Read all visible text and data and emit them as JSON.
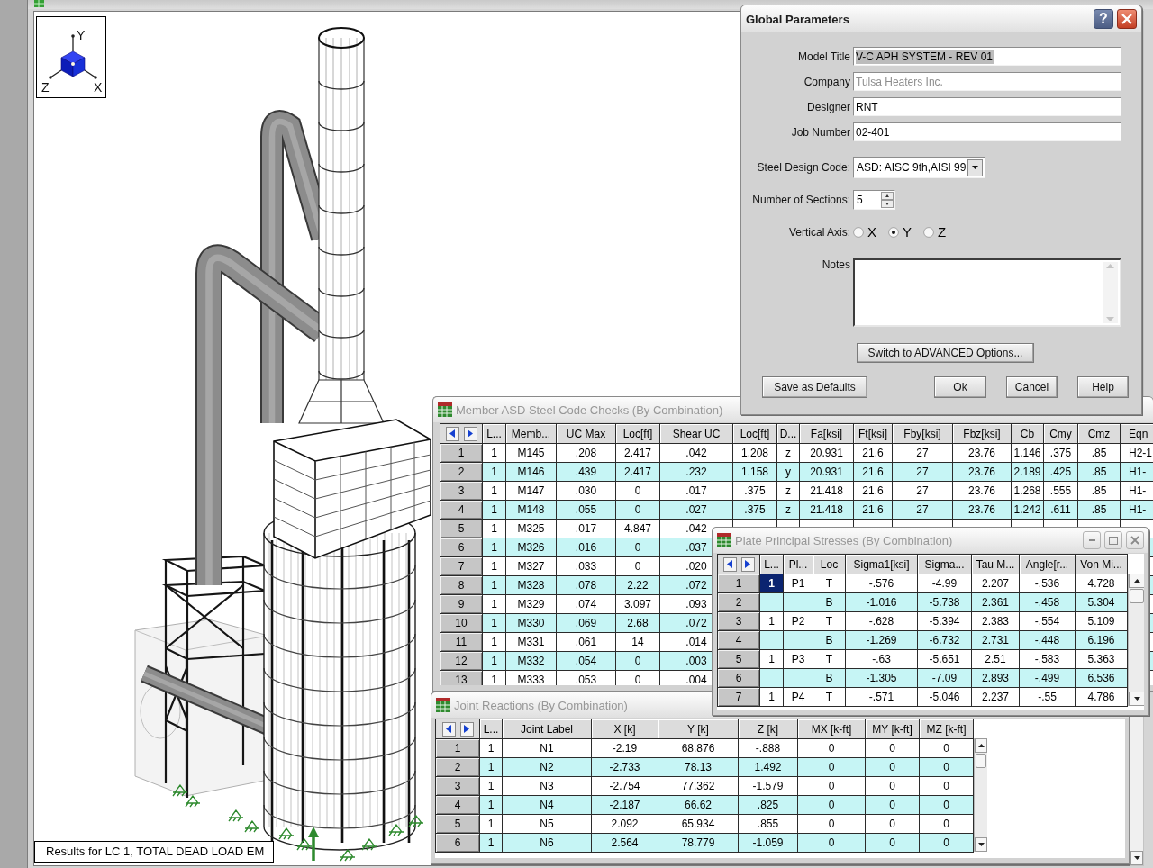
{
  "main_window": {
    "view": {
      "axis_labels": [
        "Y",
        "Z",
        "X"
      ]
    },
    "status": "Results for LC 1, TOTAL DEAD LOAD EM"
  },
  "global_parameters": {
    "title": "Global Parameters",
    "help_button": "?",
    "fields": [
      {
        "label": "Model Title",
        "value": "V-C APH SYSTEM - REV 01",
        "focused": true,
        "disabled": false
      },
      {
        "label": "Company",
        "value": "Tulsa Heaters Inc.",
        "focused": false,
        "disabled": true
      },
      {
        "label": "Designer",
        "value": "RNT",
        "focused": false,
        "disabled": false
      },
      {
        "label": "Job Number",
        "value": "02-401",
        "focused": false,
        "disabled": false
      }
    ],
    "steel_design_code": {
      "label": "Steel Design Code:",
      "value": "ASD: AISC 9th,AISI 99"
    },
    "number_of_sections": {
      "label": "Number of Sections:",
      "value": "5"
    },
    "vertical_axis": {
      "label": "Vertical Axis:",
      "options": [
        {
          "label": "X",
          "selected": false
        },
        {
          "label": "Y",
          "selected": true
        },
        {
          "label": "Z",
          "selected": false
        }
      ]
    },
    "notes": {
      "label": "Notes"
    },
    "advanced_button": "Switch to ADVANCED Options...",
    "buttons": [
      "Save as Defaults",
      "Ok",
      "Cancel",
      "Help"
    ]
  },
  "member_checks": {
    "title": "Member ASD Steel Code Checks (By Combination)",
    "columns": [
      "L...",
      "Memb...",
      "UC Max",
      "Loc[ft]",
      "Shear UC",
      "Loc[ft]",
      "D...",
      "Fa[ksi]",
      "Ft[ksi]",
      "Fby[ksi]",
      "Fbz[ksi]",
      "Cb",
      "Cmy",
      "Cmz",
      "Eqn"
    ],
    "rows": [
      {
        "number": "1",
        "cells": [
          "1",
          "M145",
          ".208",
          "2.417",
          ".042",
          "1.208",
          "z",
          "20.931",
          "21.6",
          "27",
          "23.76",
          "1.146",
          ".375",
          ".85",
          "H2-1"
        ]
      },
      {
        "number": "2",
        "cells": [
          "1",
          "M146",
          ".439",
          "2.417",
          ".232",
          "1.158",
          "y",
          "20.931",
          "21.6",
          "27",
          "23.76",
          "2.189",
          ".425",
          ".85",
          "H1-"
        ]
      },
      {
        "number": "3",
        "cells": [
          "1",
          "M147",
          ".030",
          "0",
          ".017",
          ".375",
          "z",
          "21.418",
          "21.6",
          "27",
          "23.76",
          "1.268",
          ".555",
          ".85",
          "H1-"
        ]
      },
      {
        "number": "4",
        "cells": [
          "1",
          "M148",
          ".055",
          "0",
          ".027",
          ".375",
          "z",
          "21.418",
          "21.6",
          "27",
          "23.76",
          "1.242",
          ".611",
          ".85",
          "H1-"
        ]
      },
      {
        "number": "5",
        "cells": [
          "1",
          "M325",
          ".017",
          "4.847",
          ".042"
        ]
      },
      {
        "number": "6",
        "cells": [
          "1",
          "M326",
          ".016",
          "0",
          ".037"
        ]
      },
      {
        "number": "7",
        "cells": [
          "1",
          "M327",
          ".033",
          "0",
          ".020"
        ]
      },
      {
        "number": "8",
        "cells": [
          "1",
          "M328",
          ".078",
          "2.22",
          ".072"
        ]
      },
      {
        "number": "9",
        "cells": [
          "1",
          "M329",
          ".074",
          "3.097",
          ".093"
        ]
      },
      {
        "number": "10",
        "cells": [
          "1",
          "M330",
          ".069",
          "2.68",
          ".072"
        ]
      },
      {
        "number": "11",
        "cells": [
          "1",
          "M331",
          ".061",
          "14",
          ".014"
        ]
      },
      {
        "number": "12",
        "cells": [
          "1",
          "M332",
          ".054",
          "0",
          ".003"
        ]
      },
      {
        "number": "13",
        "cells": [
          "1",
          "M333",
          ".053",
          "0",
          ".004"
        ]
      }
    ]
  },
  "plate_stresses": {
    "title": "Plate Principal Stresses (By Combination)",
    "columns": [
      "L...",
      "Pl...",
      "Loc",
      "Sigma1[ksi]",
      "Sigma...",
      "Tau M...",
      "Angle[r...",
      "Von Mi..."
    ],
    "rows": [
      {
        "number": "1",
        "selected": true,
        "cells": [
          "1",
          "P1",
          "T",
          "-.576",
          "-4.99",
          "2.207",
          "-.536",
          "4.728"
        ]
      },
      {
        "number": "2",
        "selected": false,
        "cells": [
          null,
          null,
          "B",
          "-1.016",
          "-5.738",
          "2.361",
          "-.458",
          "5.304"
        ]
      },
      {
        "number": "3",
        "selected": false,
        "cells": [
          "1",
          "P2",
          "T",
          "-.628",
          "-5.394",
          "2.383",
          "-.554",
          "5.109"
        ]
      },
      {
        "number": "4",
        "selected": false,
        "cells": [
          null,
          null,
          "B",
          "-1.269",
          "-6.732",
          "2.731",
          "-.448",
          "6.196"
        ]
      },
      {
        "number": "5",
        "selected": false,
        "cells": [
          "1",
          "P3",
          "T",
          "-.63",
          "-5.651",
          "2.51",
          "-.583",
          "5.363"
        ]
      },
      {
        "number": "6",
        "selected": false,
        "cells": [
          null,
          null,
          "B",
          "-1.305",
          "-7.09",
          "2.893",
          "-.499",
          "6.536"
        ]
      },
      {
        "number": "7",
        "selected": false,
        "cells": [
          "1",
          "P4",
          "T",
          "-.571",
          "-5.046",
          "2.237",
          "-.55",
          "4.786"
        ]
      }
    ]
  },
  "joint_reactions": {
    "title": "Joint Reactions (By Combination)",
    "columns": [
      "L...",
      "Joint Label",
      "X [k]",
      "Y [k]",
      "Z [k]",
      "MX [k-ft]",
      "MY [k-ft]",
      "MZ [k-ft]"
    ],
    "rows": [
      {
        "number": "1",
        "cells": [
          "1",
          "N1",
          "-2.19",
          "68.876",
          "-.888",
          "0",
          "0",
          "0"
        ]
      },
      {
        "number": "2",
        "cells": [
          "1",
          "N2",
          "-2.733",
          "78.13",
          "1.492",
          "0",
          "0",
          "0"
        ]
      },
      {
        "number": "3",
        "cells": [
          "1",
          "N3",
          "-2.754",
          "77.362",
          "-1.579",
          "0",
          "0",
          "0"
        ]
      },
      {
        "number": "4",
        "cells": [
          "1",
          "N4",
          "-2.187",
          "66.62",
          ".825",
          "0",
          "0",
          "0"
        ]
      },
      {
        "number": "5",
        "cells": [
          "1",
          "N5",
          "2.092",
          "65.934",
          ".855",
          "0",
          "0",
          "0"
        ]
      },
      {
        "number": "6",
        "cells": [
          "1",
          "N6",
          "2.564",
          "78.779",
          "-1.059",
          "0",
          "0",
          "0"
        ]
      }
    ]
  }
}
